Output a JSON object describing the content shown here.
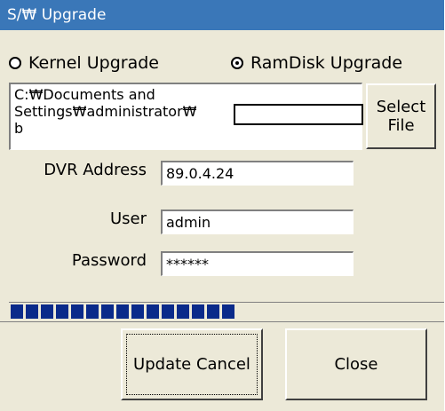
{
  "window": {
    "title": "S/₩ Upgrade"
  },
  "radios": [
    {
      "label": "Kernel Upgrade",
      "checked": false
    },
    {
      "label": "RamDisk Upgrade",
      "checked": true
    }
  ],
  "file": {
    "path_lines": [
      "C:₩Documents and",
      "Settings₩administrator₩",
      "b"
    ],
    "select_label_1": "Select",
    "select_label_2": "File"
  },
  "form": {
    "dvr_label": "DVR Address",
    "dvr_value": "89.0.4.24",
    "user_label": "User",
    "user_value": "admin",
    "password_label": "Password",
    "password_value": "******"
  },
  "progress": {
    "segments_filled": 15
  },
  "buttons": {
    "update_cancel": "Update Cancel",
    "close": "Close"
  },
  "colors": {
    "title_bar": "#3a77b8",
    "progress": "#0a2a8a",
    "dialog_bg": "#ece9d8"
  }
}
